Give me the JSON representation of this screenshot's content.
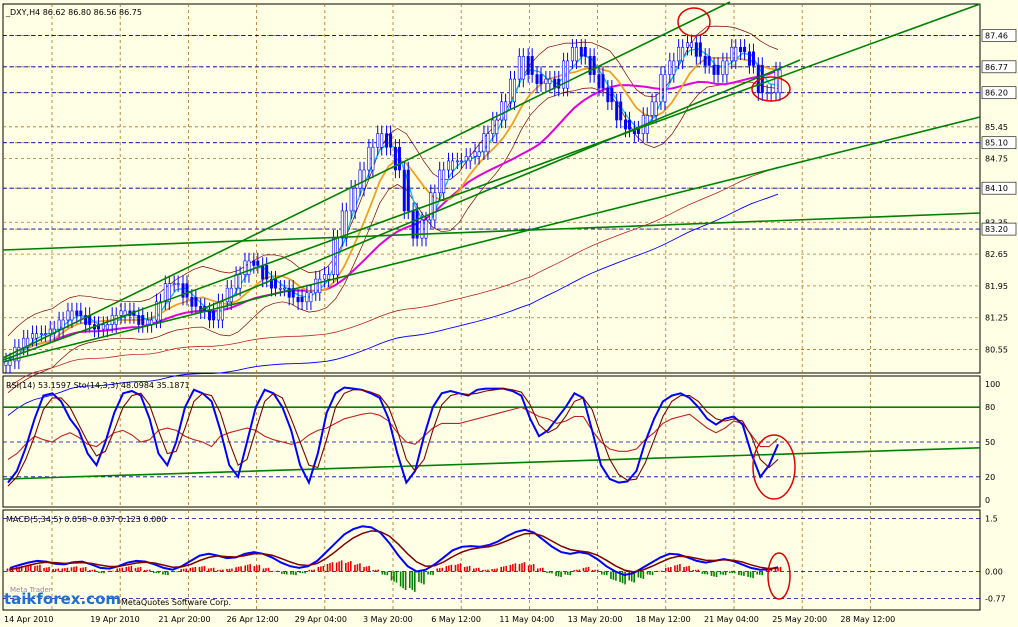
{
  "chart_data": [
    {
      "type": "line",
      "title": "_DXY,H4  86.62 86.80 86.56 86.75",
      "symbol": "_DXY",
      "timeframe": "H4",
      "ohlc": "86.62 86.80 86.56 86.75",
      "ylim": [
        80.1,
        87.8
      ],
      "y_ticks": [
        "87.46",
        "86.77",
        "86.20",
        "85.45",
        "85.10",
        "84.75",
        "84.10",
        "83.35",
        "83.20",
        "82.65",
        "81.95",
        "81.25",
        "80.55"
      ],
      "price_lines": [
        87.46,
        86.77,
        86.2,
        85.1,
        84.1,
        83.2
      ],
      "current_price": "86.77",
      "series": [
        {
          "name": "close",
          "values": [
            80.3,
            80.6,
            80.8,
            80.9,
            80.9,
            81.0,
            81.2,
            81.4,
            81.3,
            81.1,
            81.0,
            81.1,
            81.3,
            81.4,
            81.3,
            81.1,
            81.2,
            81.6,
            82.0,
            82.0,
            81.7,
            81.5,
            81.4,
            81.2,
            81.6,
            81.9,
            82.2,
            82.5,
            82.4,
            82.1,
            81.9,
            81.9,
            81.7,
            81.6,
            81.8,
            82.1,
            82.2,
            83.0,
            83.6,
            84.1,
            84.5,
            85.0,
            85.3,
            85.0,
            84.5,
            83.6,
            83.0,
            83.4,
            84.0,
            84.5,
            84.7,
            84.7,
            84.8,
            84.9,
            85.3,
            85.6,
            86.0,
            86.5,
            87.0,
            86.6,
            86.4,
            86.5,
            86.3,
            86.9,
            87.2,
            87.0,
            86.6,
            86.3,
            86.0,
            85.6,
            85.4,
            85.3,
            85.7,
            86.0,
            86.6,
            86.9,
            87.2,
            87.3,
            87.0,
            86.8,
            86.6,
            86.9,
            87.2,
            87.1,
            86.8,
            86.2,
            86.2,
            86.7
          ]
        }
      ]
    },
    {
      "type": "line",
      "title": "RSI(14) 53.1597  Sto(14,3,3) 48.0984 35.1871",
      "rsi": "53.1597",
      "sto": "48.0984 35.1871",
      "ylim": [
        0,
        100
      ],
      "y_ticks": [
        "100",
        "80",
        "50",
        "20",
        "0"
      ],
      "series": [
        {
          "name": "RSI(14)",
          "values": [
            35,
            40,
            48,
            55,
            52,
            50,
            55,
            58,
            54,
            48,
            46,
            52,
            58,
            60,
            56,
            50,
            52,
            60,
            62,
            60,
            55,
            52,
            50,
            46,
            55,
            58,
            60,
            62,
            60,
            55,
            52,
            50,
            48,
            50,
            56,
            60,
            62,
            66,
            70,
            72,
            74,
            75,
            73,
            68,
            58,
            50,
            48,
            55,
            62,
            66,
            66,
            66,
            68,
            70,
            72,
            74,
            76,
            78,
            80,
            76,
            72,
            70,
            66,
            68,
            72,
            72,
            60,
            50,
            44,
            42,
            42,
            44,
            52,
            58,
            66,
            70,
            72,
            74,
            68,
            62,
            58,
            62,
            68,
            66,
            56,
            46,
            46,
            53
          ]
        },
        {
          "name": "Sto main",
          "values": [
            15,
            25,
            45,
            70,
            90,
            92,
            85,
            70,
            60,
            40,
            30,
            50,
            75,
            92,
            94,
            90,
            70,
            40,
            30,
            50,
            80,
            95,
            92,
            85,
            60,
            30,
            20,
            50,
            80,
            95,
            92,
            80,
            60,
            30,
            15,
            40,
            75,
            92,
            97,
            96,
            95,
            92,
            88,
            70,
            40,
            15,
            25,
            55,
            80,
            92,
            94,
            92,
            90,
            95,
            96,
            96,
            96,
            94,
            90,
            70,
            55,
            60,
            70,
            80,
            92,
            88,
            60,
            30,
            18,
            15,
            16,
            25,
            50,
            70,
            85,
            90,
            92,
            88,
            80,
            70,
            65,
            70,
            72,
            65,
            40,
            20,
            30,
            48
          ]
        },
        {
          "name": "Sto signal",
          "values": [
            12,
            20,
            35,
            55,
            78,
            88,
            88,
            80,
            65,
            50,
            38,
            42,
            60,
            80,
            90,
            92,
            82,
            60,
            40,
            42,
            62,
            85,
            92,
            90,
            75,
            50,
            30,
            35,
            60,
            85,
            92,
            88,
            70,
            50,
            30,
            28,
            52,
            80,
            92,
            95,
            95,
            93,
            90,
            80,
            60,
            35,
            25,
            35,
            60,
            82,
            90,
            92,
            91,
            92,
            94,
            95,
            96,
            95,
            93,
            82,
            65,
            58,
            62,
            72,
            85,
            88,
            78,
            55,
            35,
            22,
            17,
            18,
            32,
            52,
            72,
            85,
            90,
            90,
            85,
            76,
            70,
            68,
            70,
            68,
            55,
            35,
            28,
            35
          ]
        }
      ]
    },
    {
      "type": "bar",
      "title": "MACD(5,34,5) 0.058 -0.037 0.123 0.000",
      "macd": "0.058 -0.037 0.123 0.000",
      "ylim": [
        -0.95,
        1.6
      ],
      "y_ticks": [
        "1.5",
        "0.00",
        "-0.77"
      ],
      "series": [
        {
          "name": "histogram",
          "values": [
            0.1,
            0.15,
            0.2,
            0.18,
            0.12,
            0.08,
            0.1,
            0.14,
            0.12,
            0.05,
            -0.05,
            0.02,
            0.1,
            0.15,
            0.12,
            0.05,
            -0.05,
            -0.1,
            -0.02,
            0.08,
            0.12,
            0.15,
            0.1,
            0.05,
            0.08,
            0.14,
            0.2,
            0.18,
            0.1,
            0.02,
            -0.08,
            -0.1,
            -0.05,
            0.05,
            0.15,
            0.25,
            0.3,
            0.28,
            0.22,
            0.15,
            0.05,
            -0.1,
            -0.3,
            -0.5,
            -0.55,
            -0.35,
            -0.1,
            0.1,
            0.18,
            0.22,
            0.15,
            0.1,
            0.05,
            0.08,
            0.15,
            0.22,
            0.25,
            0.2,
            0.1,
            -0.05,
            -0.15,
            -0.1,
            0.05,
            0.12,
            0.05,
            -0.1,
            -0.25,
            -0.35,
            -0.3,
            -0.2,
            -0.1,
            0.02,
            0.12,
            0.2,
            0.15,
            0.05,
            -0.08,
            -0.15,
            -0.1,
            -0.05,
            -0.12,
            -0.18,
            -0.1,
            0.05,
            0.12
          ]
        },
        {
          "name": "MACD",
          "values": [
            0.1,
            0.18,
            0.25,
            0.3,
            0.28,
            0.22,
            0.2,
            0.26,
            0.28,
            0.2,
            0.1,
            0.08,
            0.15,
            0.25,
            0.3,
            0.28,
            0.2,
            0.1,
            0.05,
            0.15,
            0.3,
            0.45,
            0.5,
            0.45,
            0.38,
            0.4,
            0.5,
            0.55,
            0.5,
            0.4,
            0.25,
            0.15,
            0.1,
            0.15,
            0.3,
            0.55,
            0.8,
            1.05,
            1.2,
            1.28,
            1.25,
            1.1,
            0.8,
            0.45,
            0.15,
            0.0,
            0.05,
            0.2,
            0.4,
            0.6,
            0.7,
            0.72,
            0.7,
            0.75,
            0.85,
            1.0,
            1.12,
            1.18,
            1.1,
            0.9,
            0.7,
            0.55,
            0.5,
            0.55,
            0.5,
            0.35,
            0.15,
            0.0,
            -0.1,
            -0.05,
            0.1,
            0.25,
            0.4,
            0.5,
            0.48,
            0.4,
            0.3,
            0.25,
            0.3,
            0.35,
            0.3,
            0.2,
            0.1,
            0.05,
            0.06,
            0.12
          ]
        },
        {
          "name": "Signal",
          "values": [
            0.05,
            0.1,
            0.17,
            0.23,
            0.26,
            0.25,
            0.23,
            0.24,
            0.25,
            0.23,
            0.18,
            0.14,
            0.14,
            0.19,
            0.24,
            0.26,
            0.24,
            0.18,
            0.12,
            0.13,
            0.2,
            0.31,
            0.4,
            0.44,
            0.42,
            0.41,
            0.45,
            0.5,
            0.5,
            0.46,
            0.37,
            0.27,
            0.19,
            0.17,
            0.23,
            0.37,
            0.56,
            0.77,
            0.95,
            1.08,
            1.15,
            1.13,
            1.0,
            0.77,
            0.5,
            0.27,
            0.15,
            0.16,
            0.27,
            0.42,
            0.55,
            0.63,
            0.67,
            0.7,
            0.77,
            0.87,
            0.98,
            1.07,
            1.08,
            1.0,
            0.86,
            0.72,
            0.62,
            0.58,
            0.55,
            0.46,
            0.32,
            0.16,
            0.04,
            -0.01,
            0.04,
            0.14,
            0.26,
            0.37,
            0.43,
            0.42,
            0.37,
            0.32,
            0.31,
            0.33,
            0.32,
            0.27,
            0.19,
            0.12,
            0.08,
            0.1
          ]
        }
      ]
    }
  ],
  "x_labels": [
    "14 Apr 2010",
    "19 Apr 2010",
    "21 Apr 20:00",
    "26 Apr 12:00",
    "29 Apr 04:00",
    "3 May 20:00",
    "6 May 12:00",
    "11 May 04:00",
    "13 May 20:00",
    "18 May 12:00",
    "21 May 04:00",
    "25 May 20:00",
    "28 May 12:00"
  ],
  "watermark": {
    "site": "taikforex.com",
    "copyright": "MetaQuotes Software Corp.",
    "brand_text": "Meta Trader"
  },
  "colors": {
    "background": "#ffffe6",
    "bull": "#0000ff",
    "fast_ma": "#00c0ff",
    "ma_orange": "#f0a020",
    "ma_magenta": "#e000e0",
    "ma_red": "#c02020",
    "ma_blue": "#0000ff",
    "trend": "#008000",
    "annotation": "#e00000"
  }
}
